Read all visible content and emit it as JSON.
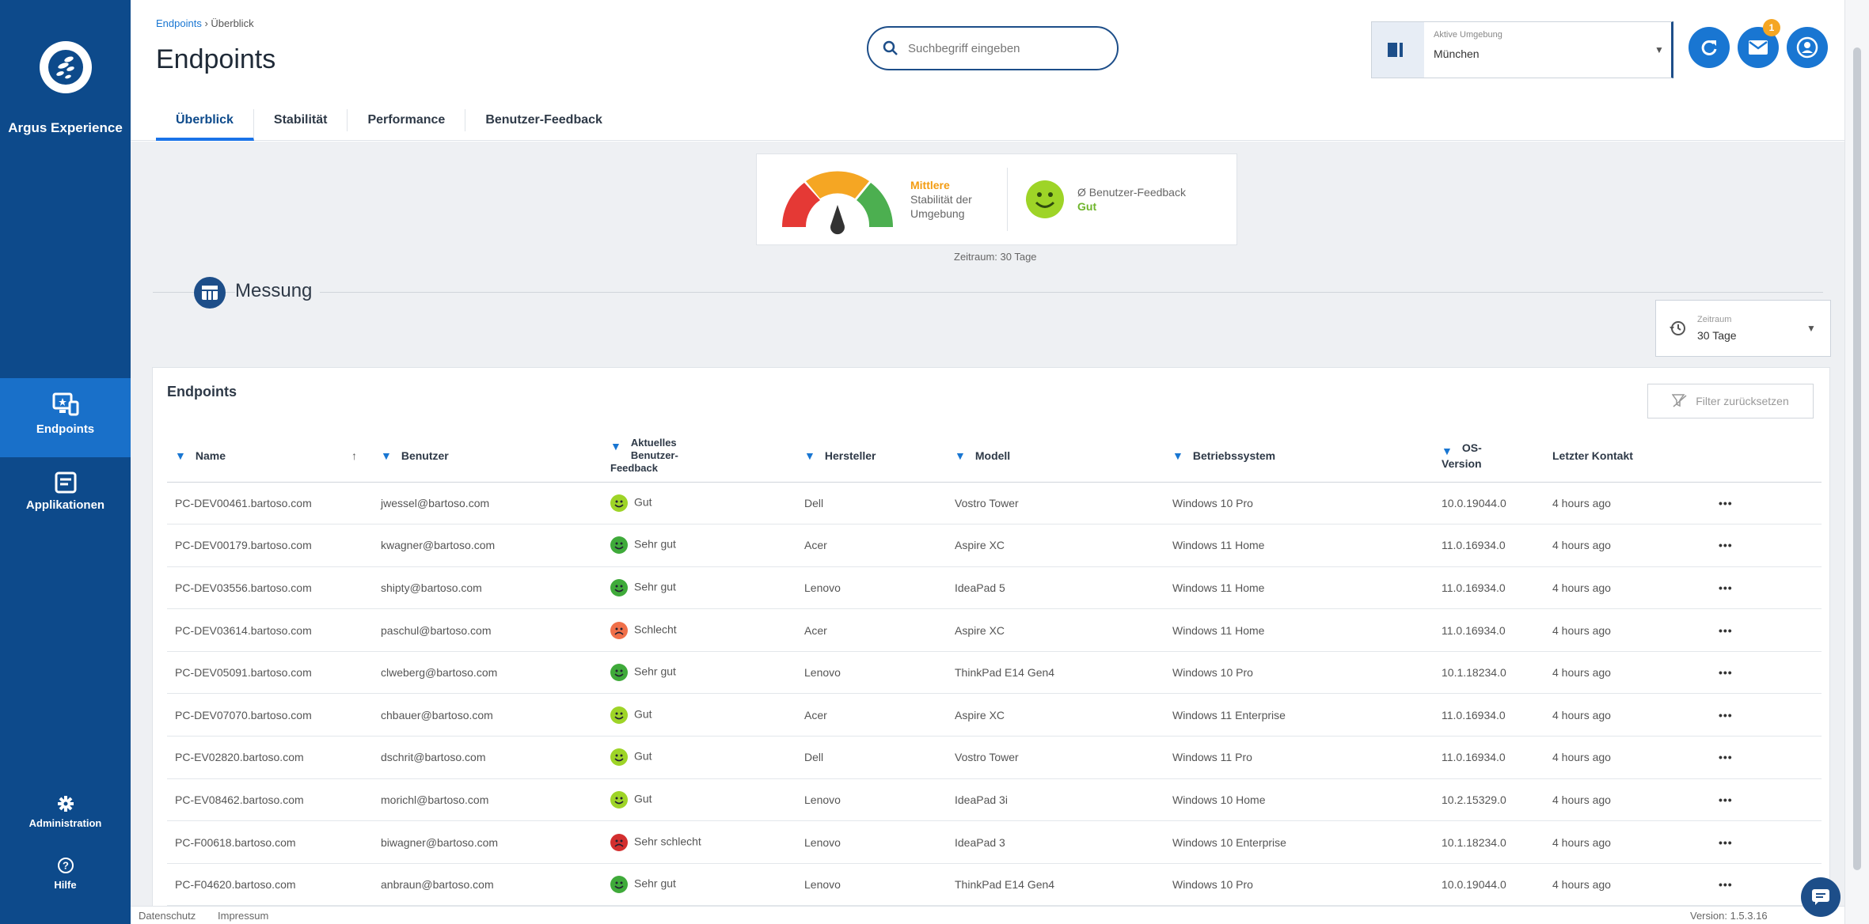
{
  "sidebar": {
    "brand": "Argus Experience",
    "items": [
      {
        "label": "Endpoints",
        "icon": "endpoints-icon",
        "active": true
      },
      {
        "label": "Applikationen",
        "icon": "applications-icon",
        "active": false
      }
    ],
    "admin_label": "Administration",
    "help_label": "Hilfe"
  },
  "header": {
    "breadcrumb": {
      "root": "Endpoints",
      "separator": " › ",
      "current": "Überblick"
    },
    "title": "Endpoints",
    "tabs": [
      "Überblick",
      "Stabilität",
      "Performance",
      "Benutzer-Feedback"
    ],
    "active_tab": "Überblick",
    "search_placeholder": "Suchbegriff eingeben",
    "environment": {
      "label": "Aktive Umgebung",
      "value": "München"
    },
    "notification_count": "1"
  },
  "summary": {
    "stability_level": "Mittlere",
    "stability_text": "Stabilität der Umgebung",
    "feedback_text": "Ø Benutzer-Feedback",
    "feedback_value": "Gut",
    "period_note": "Zeitraum: 30 Tage"
  },
  "measurement": {
    "title": "Messung",
    "period_label": "Zeitraum",
    "period_value": "30 Tage"
  },
  "table": {
    "title": "Endpoints",
    "reset_label": "Filter zurücksetzen",
    "columns": [
      "Name",
      "Benutzer",
      "Aktuelles Benutzer-Feedback",
      "Hersteller",
      "Modell",
      "Betriebssystem",
      "OS-Version",
      "Letzter Kontakt"
    ],
    "rows": [
      {
        "name": "PC-DEV00461.bartoso.com",
        "user": "jwessel@bartoso.com",
        "feedback": "Gut",
        "mood": "good",
        "vendor": "Dell",
        "model": "Vostro Tower",
        "os": "Windows 10 Pro",
        "version": "10.0.19044.0",
        "contact": "4 hours ago"
      },
      {
        "name": "PC-DEV00179.bartoso.com",
        "user": "kwagner@bartoso.com",
        "feedback": "Sehr gut",
        "mood": "very-good",
        "vendor": "Acer",
        "model": "Aspire XC",
        "os": "Windows 11 Home",
        "version": "11.0.16934.0",
        "contact": "4 hours ago"
      },
      {
        "name": "PC-DEV03556.bartoso.com",
        "user": "shipty@bartoso.com",
        "feedback": "Sehr gut",
        "mood": "very-good",
        "vendor": "Lenovo",
        "model": "IdeaPad 5",
        "os": "Windows 11 Home",
        "version": "11.0.16934.0",
        "contact": "4 hours ago"
      },
      {
        "name": "PC-DEV03614.bartoso.com",
        "user": "paschul@bartoso.com",
        "feedback": "Schlecht",
        "mood": "bad",
        "vendor": "Acer",
        "model": "Aspire XC",
        "os": "Windows 11 Home",
        "version": "11.0.16934.0",
        "contact": "4 hours ago"
      },
      {
        "name": "PC-DEV05091.bartoso.com",
        "user": "clweberg@bartoso.com",
        "feedback": "Sehr gut",
        "mood": "very-good",
        "vendor": "Lenovo",
        "model": "ThinkPad E14 Gen4",
        "os": "Windows 10 Pro",
        "version": "10.1.18234.0",
        "contact": "4 hours ago"
      },
      {
        "name": "PC-DEV07070.bartoso.com",
        "user": "chbauer@bartoso.com",
        "feedback": "Gut",
        "mood": "good",
        "vendor": "Acer",
        "model": "Aspire XC",
        "os": "Windows 11 Enterprise",
        "version": "11.0.16934.0",
        "contact": "4 hours ago"
      },
      {
        "name": "PC-EV02820.bartoso.com",
        "user": "dschrit@bartoso.com",
        "feedback": "Gut",
        "mood": "good",
        "vendor": "Dell",
        "model": "Vostro Tower",
        "os": "Windows 11 Pro",
        "version": "11.0.16934.0",
        "contact": "4 hours ago"
      },
      {
        "name": "PC-EV08462.bartoso.com",
        "user": "morichl@bartoso.com",
        "feedback": "Gut",
        "mood": "good",
        "vendor": "Lenovo",
        "model": "IdeaPad 3i",
        "os": "Windows 10 Home",
        "version": "10.2.15329.0",
        "contact": "4 hours ago"
      },
      {
        "name": "PC-F00618.bartoso.com",
        "user": "biwagner@bartoso.com",
        "feedback": "Sehr schlecht",
        "mood": "very-bad",
        "vendor": "Lenovo",
        "model": "IdeaPad 3",
        "os": "Windows 10 Enterprise",
        "version": "10.1.18234.0",
        "contact": "4 hours ago"
      },
      {
        "name": "PC-F04620.bartoso.com",
        "user": "anbraun@bartoso.com",
        "feedback": "Sehr gut",
        "mood": "very-good",
        "vendor": "Lenovo",
        "model": "ThinkPad E14 Gen4",
        "os": "Windows 10 Pro",
        "version": "10.0.19044.0",
        "contact": "4 hours ago"
      }
    ]
  },
  "footer": {
    "privacy": "Datenschutz",
    "imprint": "Impressum",
    "version": "Version: 1.5.3.16"
  },
  "colors": {
    "sidebar": "#0d4a8b",
    "active": "#1970c9",
    "good": "#9ed427",
    "very_good": "#3faa3a",
    "bad": "#f0704a",
    "very_bad": "#d32f2f"
  }
}
